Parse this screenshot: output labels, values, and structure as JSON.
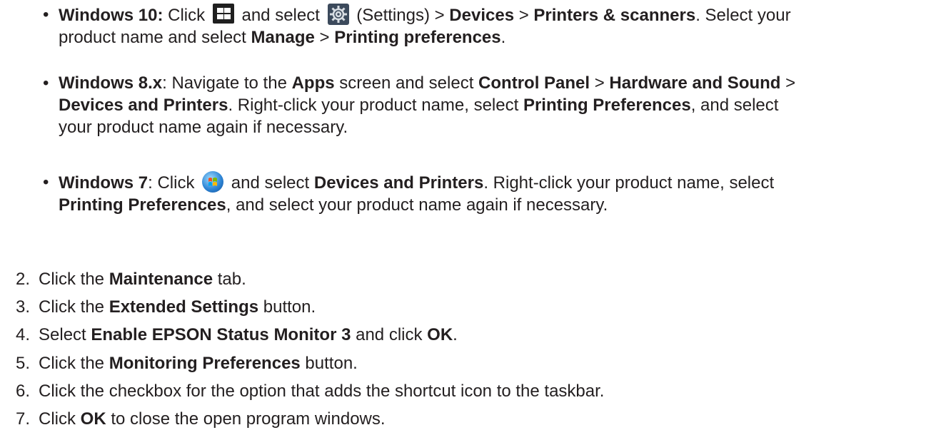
{
  "bullets": [
    {
      "id": "win10",
      "segments": [
        {
          "t": "Windows 10:",
          "b": true
        },
        {
          "t": " Click ",
          "b": false
        },
        {
          "icon": "windows-start-icon"
        },
        {
          "t": " and select ",
          "b": false
        },
        {
          "icon": "settings-gear-icon"
        },
        {
          "t": " (Settings) > ",
          "b": false
        },
        {
          "t": "Devices",
          "b": true
        },
        {
          "t": " > ",
          "b": false
        },
        {
          "t": "Printers & scanners",
          "b": true
        },
        {
          "t": ". Select your",
          "b": false
        },
        {
          "br": true
        },
        {
          "t": "product name and select ",
          "b": false
        },
        {
          "t": "Manage",
          "b": true
        },
        {
          "t": " > ",
          "b": false
        },
        {
          "t": "Printing preferences",
          "b": true
        },
        {
          "t": ".",
          "b": false
        }
      ]
    },
    {
      "id": "win8",
      "segments": [
        {
          "t": "Windows 8.x",
          "b": true
        },
        {
          "t": ": Navigate to the ",
          "b": false
        },
        {
          "t": "Apps",
          "b": true
        },
        {
          "t": " screen and select ",
          "b": false
        },
        {
          "t": "Control Panel",
          "b": true
        },
        {
          "t": " > ",
          "b": false
        },
        {
          "t": "Hardware and Sound",
          "b": true
        },
        {
          "t": " >",
          "b": false
        },
        {
          "br": true
        },
        {
          "t": "Devices and Printers",
          "b": true
        },
        {
          "t": ". Right-click your product name, select ",
          "b": false
        },
        {
          "t": "Printing Preferences",
          "b": true
        },
        {
          "t": ", and select",
          "b": false
        },
        {
          "br": true
        },
        {
          "t": "your product name again if necessary.",
          "b": false
        }
      ]
    },
    {
      "id": "win7",
      "segments": [
        {
          "t": "Windows 7",
          "b": true
        },
        {
          "t": ": Click ",
          "b": false
        },
        {
          "icon": "windows7-start-orb-icon"
        },
        {
          "t": " and select ",
          "b": false
        },
        {
          "t": "Devices and Printers",
          "b": true
        },
        {
          "t": ". Right-click your product name, select",
          "b": false
        },
        {
          "br": true
        },
        {
          "t": "Printing Preferences",
          "b": true
        },
        {
          "t": ", and select your product name again if necessary.",
          "b": false
        }
      ]
    }
  ],
  "steps": [
    {
      "num": "2.",
      "segments": [
        {
          "t": "Click the ",
          "b": false
        },
        {
          "t": "Maintenance",
          "b": true
        },
        {
          "t": " tab.",
          "b": false
        }
      ]
    },
    {
      "num": "3.",
      "segments": [
        {
          "t": "Click the ",
          "b": false
        },
        {
          "t": "Extended Settings",
          "b": true
        },
        {
          "t": " button.",
          "b": false
        }
      ]
    },
    {
      "num": "4.",
      "segments": [
        {
          "t": "Select ",
          "b": false
        },
        {
          "t": "Enable EPSON Status Monitor 3",
          "b": true
        },
        {
          "t": " and click ",
          "b": false
        },
        {
          "t": "OK",
          "b": true
        },
        {
          "t": ".",
          "b": false
        }
      ]
    },
    {
      "num": "5.",
      "segments": [
        {
          "t": "Click the ",
          "b": false
        },
        {
          "t": "Monitoring Preferences",
          "b": true
        },
        {
          "t": " button.",
          "b": false
        }
      ]
    },
    {
      "num": "6.",
      "segments": [
        {
          "t": "Click the checkbox for the option that adds the shortcut icon to the taskbar.",
          "b": false
        }
      ]
    },
    {
      "num": "7.",
      "segments": [
        {
          "t": "Click ",
          "b": false
        },
        {
          "t": "OK",
          "b": true
        },
        {
          "t": " to close the open program windows.",
          "b": false
        }
      ]
    }
  ]
}
